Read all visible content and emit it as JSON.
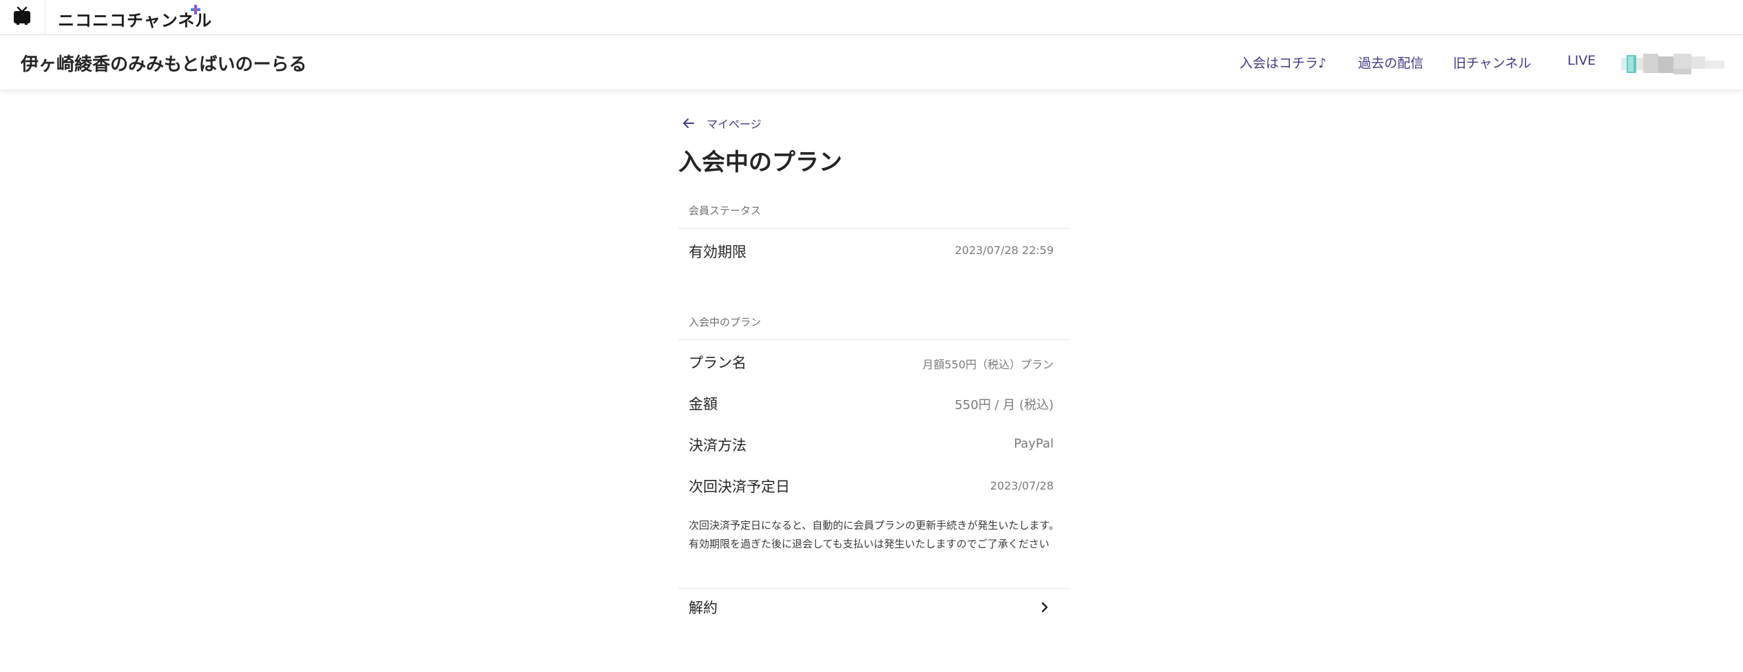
{
  "topbar": {
    "brand": "ニコニコチャンネル",
    "logo_icon": "niconico-tv-icon",
    "plus_icon": "plus-icon",
    "plus_colors": [
      "#1f8cff",
      "#ff3c78",
      "#8a4dff"
    ]
  },
  "channel": {
    "title": "伊ヶ崎綾香のみみもとばいのーらる",
    "nav": {
      "join": "入会はコチラ♪",
      "past": "過去の配信",
      "old": "旧チャンネル",
      "live": "LIVE"
    },
    "avatar_icon": "user-avatar"
  },
  "page": {
    "back_label": "マイページ",
    "back_icon": "arrow-left-icon",
    "title": "入会中のプラン"
  },
  "status_section": {
    "label": "会員ステータス",
    "rows": [
      {
        "label": "有効期限",
        "value": "2023/07/28 22:59"
      }
    ]
  },
  "plan_section": {
    "label": "入会中のプラン",
    "rows": [
      {
        "label": "プラン名",
        "value": "月額550円（税込）プラン"
      },
      {
        "label": "金額",
        "value": "550円 / 月 (税込)"
      },
      {
        "label": "決済方法",
        "value": "PayPal"
      },
      {
        "label": "次回決済予定日",
        "value": "2023/07/28"
      }
    ],
    "notice_lines": [
      "次回決済予定日になると、自動的に会員プランの更新手続きが発生いたします。",
      "有効期限を過ぎた後に退会しても支払いは発生いたしますのでご了承ください"
    ]
  },
  "cancel": {
    "label": "解約",
    "icon": "chevron-right-icon"
  },
  "colors": {
    "accent": "#3f3a8c",
    "text": "#252525",
    "muted": "#7a7a7a",
    "divider": "#e3e3e3"
  }
}
